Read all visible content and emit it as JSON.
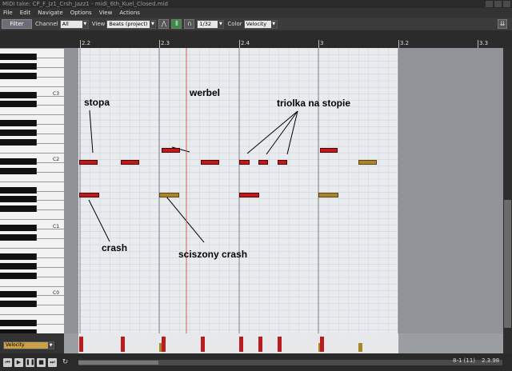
{
  "titlebar": {
    "title": "MIDI take: CP_F_Jz1_Crsh_Jazz1 - midi_6th_Kuel_Closed.mid"
  },
  "menu": [
    "File",
    "Edit",
    "Navigate",
    "Options",
    "View",
    "Actions"
  ],
  "toolbar": {
    "filter_label": "Filter",
    "channel_label": "Channel",
    "channel_value": "All",
    "view_label": "View",
    "view_value": "Beats (project)",
    "grid_value": "1/32",
    "color_label": "Color",
    "color_value": "Velocity"
  },
  "ruler": {
    "labels": [
      "2.2",
      "2.3",
      "2.4",
      "3",
      "3.2",
      "3.3"
    ]
  },
  "keyboard": {
    "octave_labels": [
      "C3",
      "C2",
      "C1",
      "C0"
    ]
  },
  "annotations": {
    "stopa": "stopa",
    "werbel": "werbel",
    "triolka": "triolka na stopie",
    "crash": "crash",
    "sciszony": "sciszony crash"
  },
  "notes": {
    "high": [
      {
        "id": "werbel-1",
        "muted": false
      },
      {
        "id": "werbel-2",
        "muted": false
      }
    ],
    "middle": [
      {
        "id": "stopa-1",
        "muted": false
      },
      {
        "id": "stopa-2",
        "muted": false
      },
      {
        "id": "stopa-3",
        "muted": false
      },
      {
        "id": "triola-1",
        "muted": false
      },
      {
        "id": "triola-2",
        "muted": false
      },
      {
        "id": "triola-3",
        "muted": false
      },
      {
        "id": "stopa-4",
        "muted": true
      }
    ],
    "low": [
      {
        "id": "crash-1",
        "muted": false
      },
      {
        "id": "crash-2",
        "muted": true
      },
      {
        "id": "crash-3",
        "muted": false
      },
      {
        "id": "crash-4",
        "muted": true
      }
    ]
  },
  "velocity": {
    "lane_value": "Velocity"
  },
  "status": {
    "selection": "8-1 (11)",
    "position": "2.3.98"
  },
  "colors": {
    "note": "#b81c1c",
    "muted_note": "#a8842a",
    "playhead": "#d06040",
    "grid_bg": "#e9ecef"
  }
}
